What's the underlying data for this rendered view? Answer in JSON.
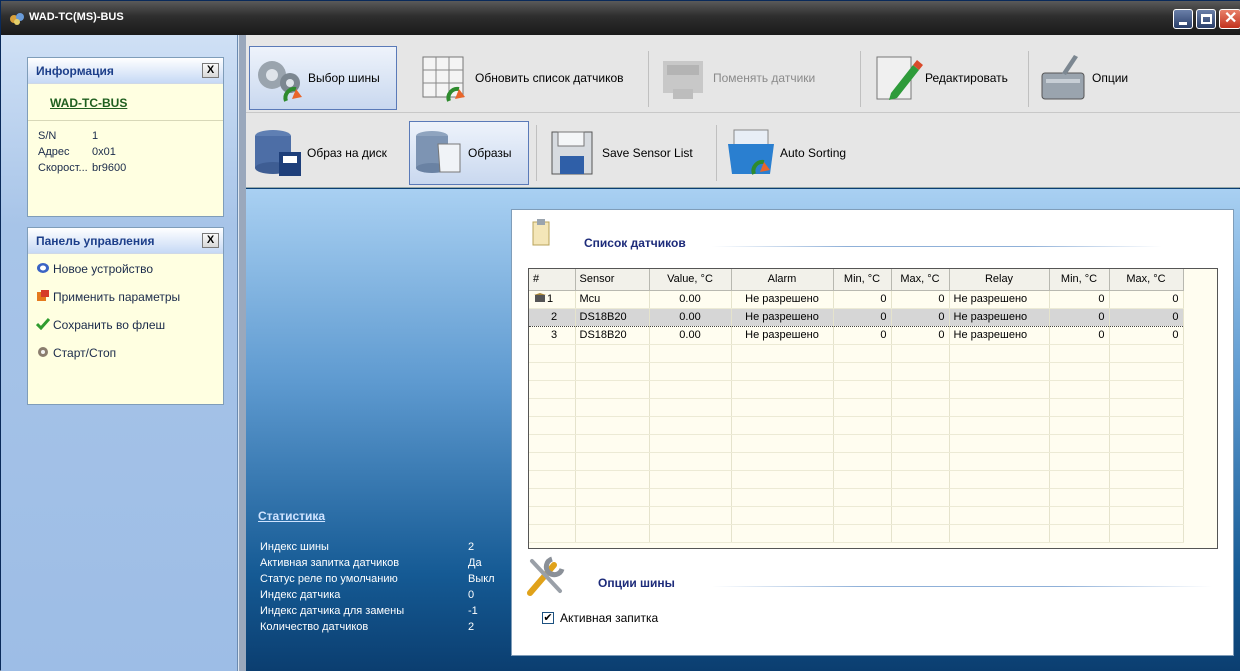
{
  "window": {
    "title": "WAD-TC(MS)-BUS"
  },
  "info_box": {
    "title": "Информация",
    "close_label": "X",
    "device_link": "WAD-TC-BUS",
    "rows": [
      {
        "key": "S/N",
        "value": "1"
      },
      {
        "key": "Адрес",
        "value": "0x01"
      },
      {
        "key": "Скорост...",
        "value": "br9600"
      }
    ]
  },
  "control_panel": {
    "title": "Панель управления",
    "close_label": "X",
    "items": [
      {
        "label": "Новое устройство",
        "icon": "new-device-icon"
      },
      {
        "label": "Применить параметры",
        "icon": "apply-params-icon"
      },
      {
        "label": "Сохранить во флеш",
        "icon": "checkmark-icon"
      },
      {
        "label": "Старт/Стоп",
        "icon": "gear-icon"
      }
    ]
  },
  "toolbar": {
    "row1": [
      {
        "label": "Выбор шины",
        "icon": "gears-refresh-icon",
        "enabled": true,
        "selected": true
      },
      {
        "label": "Обновить список датчиков",
        "icon": "grid-refresh-icon",
        "enabled": true
      },
      {
        "label": "Поменять датчики",
        "icon": "swap-sensors-icon",
        "enabled": false
      },
      {
        "label": "Редактировать",
        "icon": "edit-pencil-icon",
        "enabled": true
      },
      {
        "label": "Опции",
        "icon": "toolbox-icon",
        "enabled": true
      }
    ],
    "row2": [
      {
        "label": "Образ на диск",
        "icon": "database-save-icon",
        "enabled": true
      },
      {
        "label": "Образы",
        "icon": "database-scroll-icon",
        "enabled": true,
        "selected": true
      },
      {
        "label": "Save Sensor List",
        "icon": "floppy-disk-icon",
        "enabled": true
      },
      {
        "label": "Auto Sorting",
        "icon": "folders-sort-icon",
        "enabled": true
      }
    ]
  },
  "statistics": {
    "title": "Статистика",
    "rows": [
      {
        "key": "Индекс шины",
        "value": "2"
      },
      {
        "key": "Активная запитка датчиков",
        "value": "Да"
      },
      {
        "key": "Статус реле по умолчанию",
        "value": "Выкл"
      },
      {
        "key": "Индекс датчика",
        "value": "0"
      },
      {
        "key": "Индекс датчика для замены",
        "value": "-1"
      },
      {
        "key": "Количество датчиков",
        "value": "2"
      }
    ]
  },
  "sensor_list": {
    "title": "Список датчиков",
    "columns": [
      "#",
      "Sensor",
      "Value, °C",
      "Alarm",
      "Min, °C",
      "Max, °C",
      "Relay",
      "Min, °C",
      "Max, °C"
    ],
    "rows": [
      {
        "n": "1",
        "sensor": "Mcu",
        "value": "0.00",
        "alarm": "Не разрешено",
        "min1": "0",
        "max1": "0",
        "relay": "Не разрешено",
        "min2": "0",
        "max2": "0",
        "icon": "mcu-chip-icon",
        "selected": false
      },
      {
        "n": "2",
        "sensor": "DS18B20",
        "value": "0.00",
        "alarm": "Не разрешено",
        "min1": "0",
        "max1": "0",
        "relay": "Не разрешено",
        "min2": "0",
        "max2": "0",
        "selected": true
      },
      {
        "n": "3",
        "sensor": "DS18B20",
        "value": "0.00",
        "alarm": "Не разрешено",
        "min1": "0",
        "max1": "0",
        "relay": "Не разрешено",
        "min2": "0",
        "max2": "0",
        "selected": false
      }
    ]
  },
  "bus_options": {
    "title": "Опции шины",
    "active_power": {
      "label": "Активная запитка",
      "checked": true
    }
  },
  "colors": {
    "accent": "#1d2b7a",
    "title_bar": "#2e2e2e",
    "content_top": "#a9d0f2",
    "content_bottom": "#0b3e70",
    "info_bg": "#ffffe1"
  }
}
